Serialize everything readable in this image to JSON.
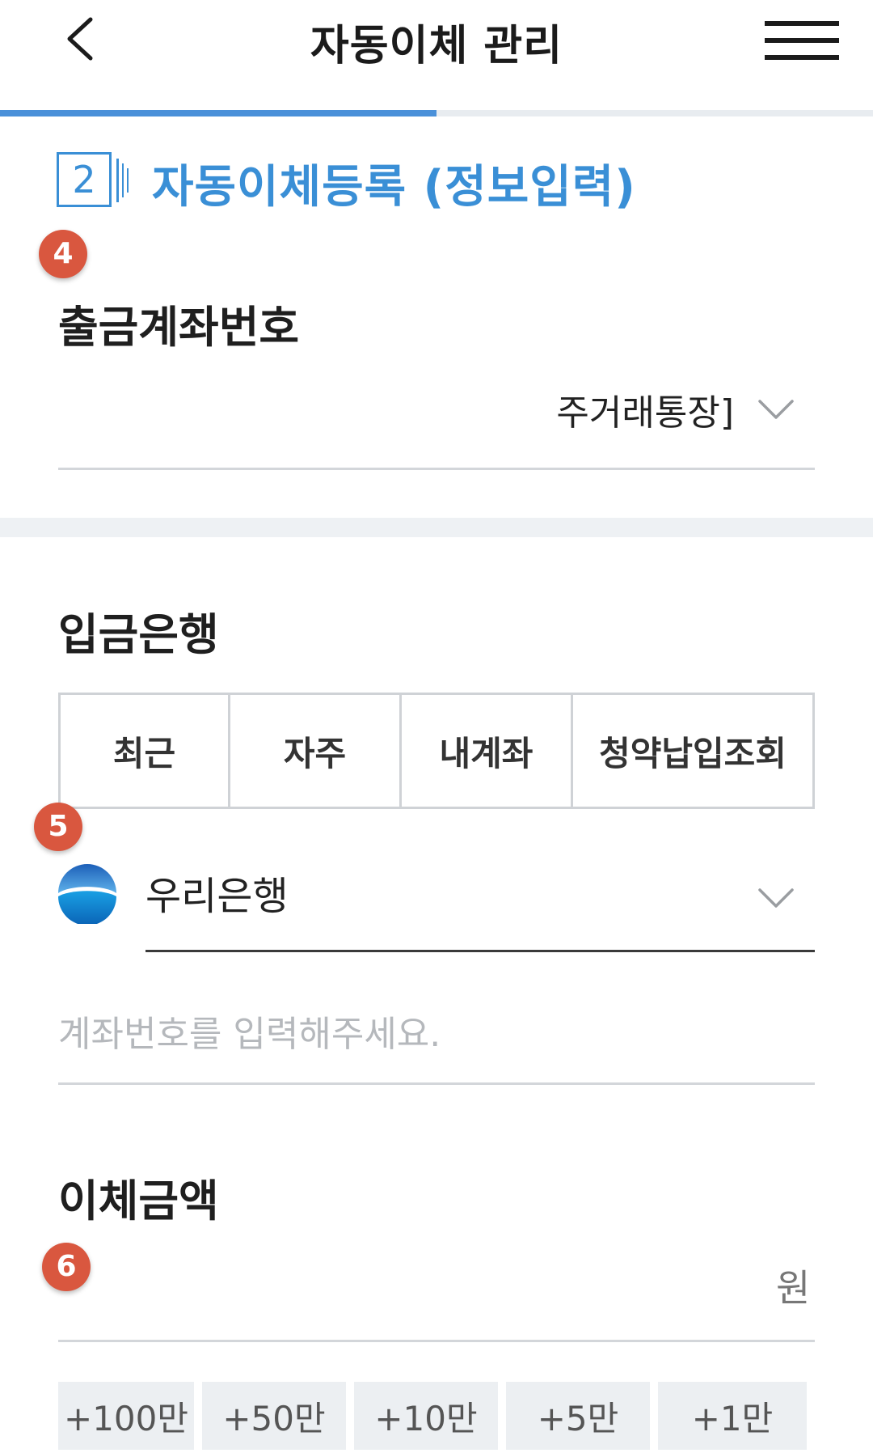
{
  "header": {
    "title": "자동이체 관리",
    "back_icon": "chevron-left-icon",
    "menu_icon": "hamburger-menu-icon"
  },
  "progress": {
    "fraction": 0.5,
    "color": "#4a90d9"
  },
  "step": {
    "number": "2",
    "title": "자동이체등록 (정보입력)",
    "color": "#3a8fd6"
  },
  "badges": [
    "4",
    "5",
    "6"
  ],
  "withdrawal": {
    "label": "출금계좌번호",
    "selected_value": "주거래통장]"
  },
  "deposit": {
    "label": "입금은행",
    "tabs": [
      "최근",
      "자주",
      "내계좌",
      "청약납입조회"
    ],
    "bank_name": "우리은행",
    "account_placeholder": "계좌번호를 입력해주세요."
  },
  "amount": {
    "label": "이체금액",
    "unit": "원",
    "quick_buttons": [
      "+100만",
      "+50만",
      "+10만",
      "+5만",
      "+1만"
    ]
  },
  "colors": {
    "accent": "#3a8fd6",
    "badge": "#d9573f",
    "divider": "#d3d6da",
    "section_bg": "#eef1f4"
  }
}
